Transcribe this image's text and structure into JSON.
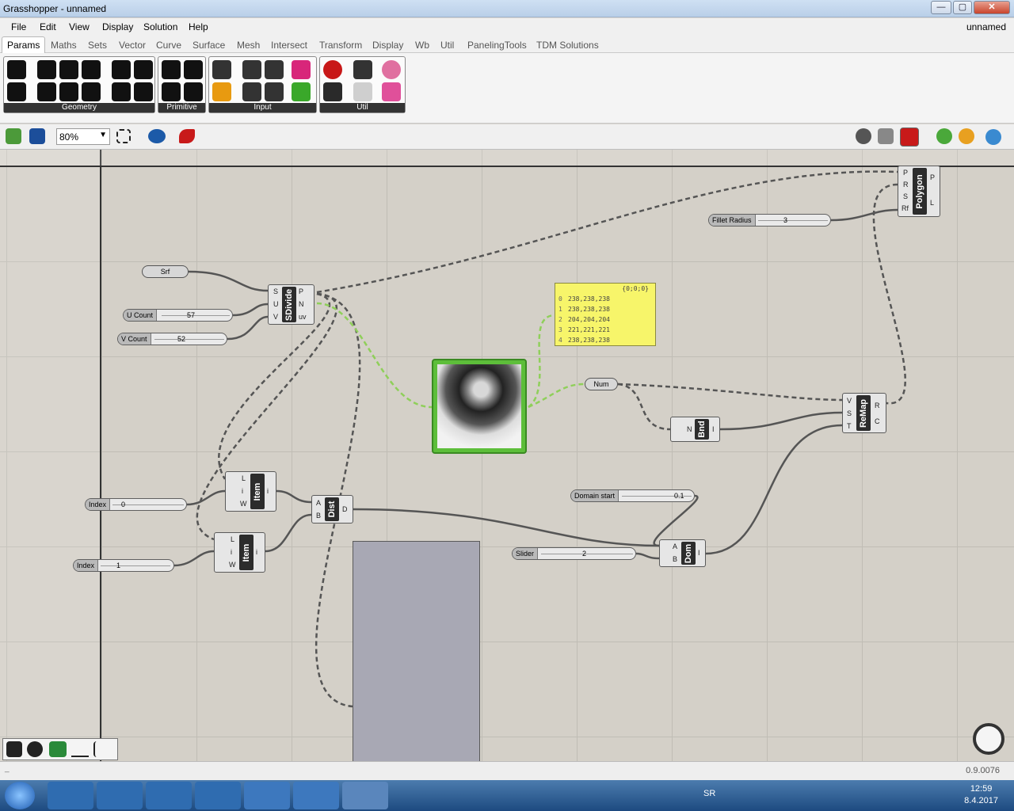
{
  "window": {
    "title": "Grasshopper - unnamed",
    "doc_name": "unnamed",
    "btn_min": "—",
    "btn_max": "▢",
    "btn_close": "✕"
  },
  "menu": [
    "File",
    "Edit",
    "View",
    "Display",
    "Solution",
    "Help"
  ],
  "tabs": [
    "Params",
    "Maths",
    "Sets",
    "Vector",
    "Curve",
    "Surface",
    "Mesh",
    "Intersect",
    "Transform",
    "Display",
    "Wb",
    "Util",
    "PanelingTools",
    "TDM Solutions"
  ],
  "ribbon_groups": [
    "Geometry",
    "Primitive",
    "Input",
    "Util"
  ],
  "toolbar": {
    "zoom": "80%"
  },
  "components": {
    "srf": "Srf",
    "ucount_label": "U Count",
    "ucount_value": "57",
    "vcount_label": "V Count",
    "vcount_value": "52",
    "sdivide": "SDivide",
    "sdivide_in": [
      "S",
      "U",
      "V"
    ],
    "sdivide_out": [
      "P",
      "N",
      "uv"
    ],
    "fillet_label": "Fillet Radius",
    "fillet_value": "3",
    "polygon": "Polygon",
    "polygon_in": [
      "P",
      "R",
      "S",
      "Rf"
    ],
    "polygon_out": [
      "P",
      "L"
    ],
    "num": "Num",
    "bnd": "Bnd",
    "bnd_in": "N",
    "bnd_out": "I",
    "remap": "ReMap",
    "remap_in": [
      "V",
      "S",
      "T"
    ],
    "remap_out": [
      "R",
      "C"
    ],
    "index0_label": "Index",
    "index0_value": "0",
    "index1_label": "Index",
    "index1_value": "1",
    "item": "Item",
    "item_in": [
      "L",
      "i",
      "W"
    ],
    "item_out": "i",
    "dist": "Dist",
    "dist_in": [
      "A",
      "B"
    ],
    "dist_out": "D",
    "domain_label": "Domain start",
    "domain_value": "0.1",
    "slider_label": "Slider",
    "slider_value": "2",
    "dom": "Dom",
    "dom_in": [
      "A",
      "B"
    ],
    "dom_out": "I"
  },
  "panel_note": {
    "path": "{0;0;0}",
    "rows": [
      {
        "i": "0",
        "v": "238,238,238"
      },
      {
        "i": "1",
        "v": "238,238,238"
      },
      {
        "i": "2",
        "v": "204,204,204"
      },
      {
        "i": "3",
        "v": "221,221,221"
      },
      {
        "i": "4",
        "v": "238,238,238"
      }
    ]
  },
  "status": {
    "version": "0.9.0076",
    "dash": "_"
  },
  "taskbar": {
    "lang": "SR",
    "time": "12:59",
    "date": "8.4.2017"
  },
  "colors": {
    "wire": "#555555",
    "wire_selected": "#8fcf5a",
    "canvas": "#d4d0c8",
    "panel_yellow": "#f7f56a"
  }
}
